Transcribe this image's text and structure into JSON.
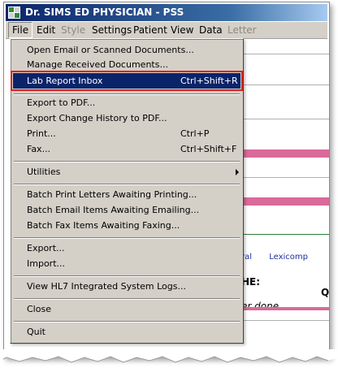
{
  "window": {
    "title": "Dr. SIMS ED PHYSICIAN - PSS"
  },
  "menubar": {
    "items": [
      {
        "label": "File",
        "state": "active"
      },
      {
        "label": "Edit",
        "state": "normal"
      },
      {
        "label": "Style",
        "state": "disabled"
      },
      {
        "label": "Settings",
        "state": "normal"
      },
      {
        "label": "Patient",
        "state": "normal"
      },
      {
        "label": "View",
        "state": "normal"
      },
      {
        "label": "Data",
        "state": "normal"
      },
      {
        "label": "Letter",
        "state": "disabled"
      }
    ]
  },
  "file_menu": {
    "open_email": "Open Email or Scanned Documents...",
    "manage_received": "Manage Received Documents...",
    "lab_inbox": "Lab Report Inbox",
    "lab_inbox_shortcut": "Ctrl+Shift+R",
    "export_pdf": "Export to PDF...",
    "export_history_pdf": "Export Change History to PDF...",
    "print": "Print...",
    "print_shortcut": "Ctrl+P",
    "fax": "Fax...",
    "fax_shortcut": "Ctrl+Shift+F",
    "utilities": "Utilities",
    "batch_print": "Batch Print Letters Awaiting Printing...",
    "batch_email": "Batch Email Items Awaiting Emailing...",
    "batch_fax": "Batch Fax Items Awaiting Faxing...",
    "export": "Export...",
    "import": "Import...",
    "view_hl7": "View HL7 Integrated System Logs...",
    "close": "Close",
    "quit": "Quit"
  },
  "background": {
    "link_1": "ral",
    "link_2": "Lexicomp",
    "heading_fragment": "HE:",
    "status_fragment": "er done",
    "edge_letter": "Q"
  },
  "colors": {
    "titlebar": "#0a246a",
    "menu_bg": "#d4d0c8",
    "highlight": "#0a246a",
    "highlight_border": "#e0201c",
    "accent_pink": "#d96a9a"
  }
}
